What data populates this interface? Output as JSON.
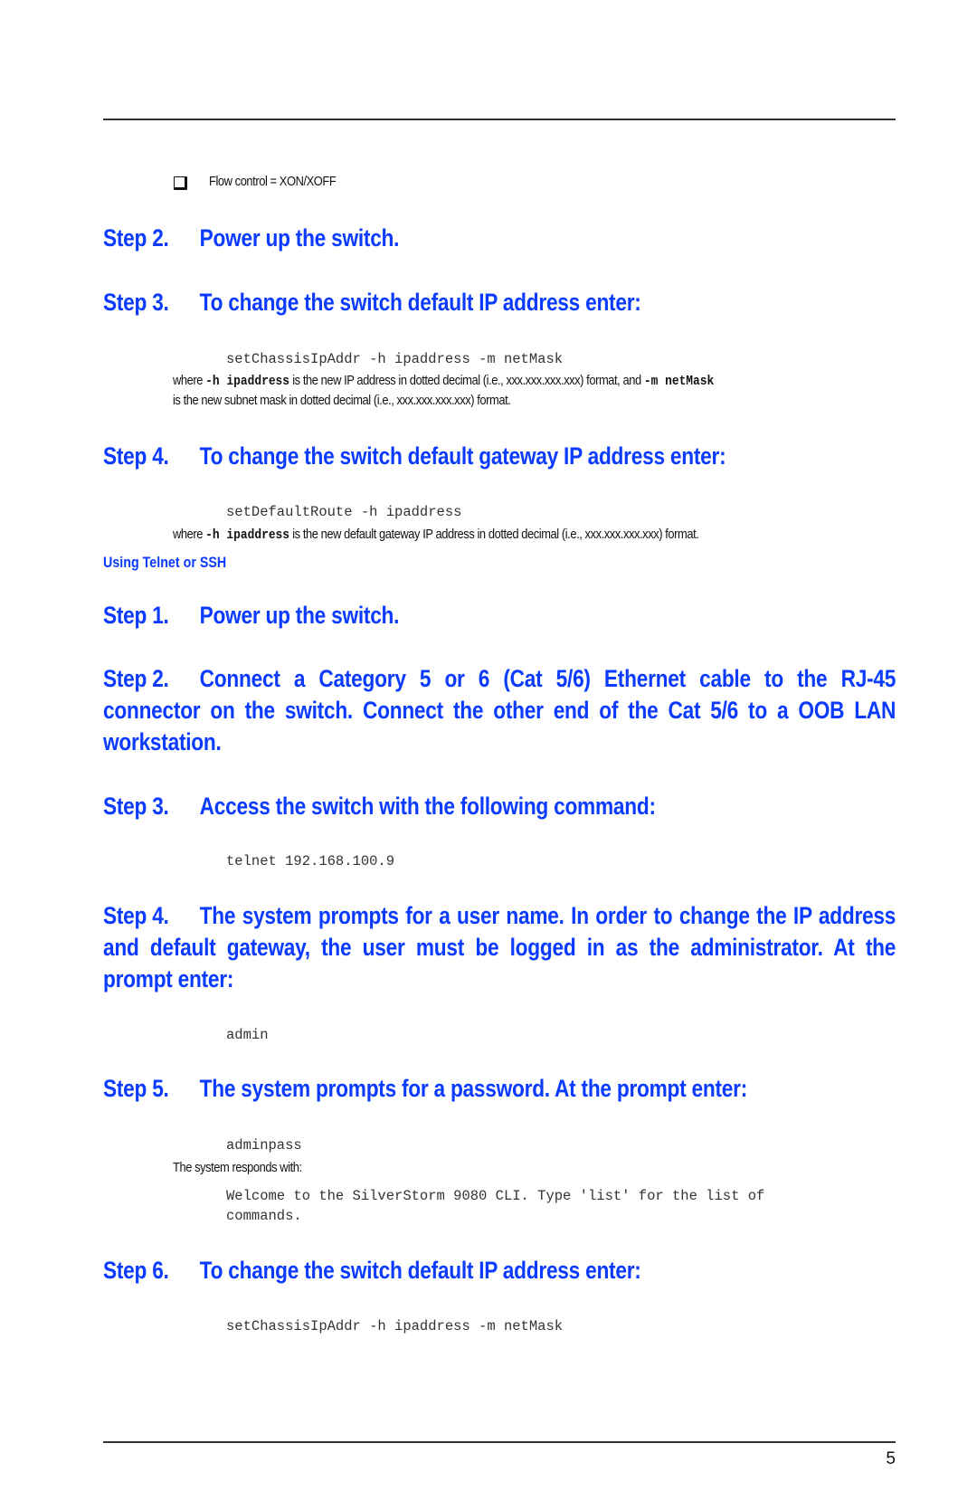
{
  "bullet": {
    "text": "Flow control = XON/XOFF"
  },
  "section1": {
    "steps": [
      {
        "num": "Step 2.",
        "text": "Power up the switch."
      },
      {
        "num": "Step 3.",
        "text": "To change the switch default IP address enter:"
      }
    ],
    "code1": "setChassisIpAddr -h ipaddress -m netMask",
    "where1": {
      "prefix": "where ",
      "flag1": "-h ipaddress",
      "mid": " is the new IP address in dotted decimal (i.e., xxx.xxx.xxx.xxx) format, and ",
      "flag2": "-m netMask",
      "line2": "is the new subnet mask in dotted decimal (i.e., xxx.xxx.xxx.xxx) format."
    },
    "step4": {
      "num": "Step 4.",
      "text": "To change the switch default gateway IP address enter:"
    },
    "code2": "setDefaultRoute -h ipaddress",
    "where2": {
      "prefix": "where ",
      "flag": "-h ipaddress",
      "rest": " is the new default gateway IP address in dotted decimal (i.e., xxx.xxx.xxx.xxx) format."
    }
  },
  "section2": {
    "title": "Using Telnet or SSH",
    "step1": {
      "num": "Step 1.",
      "text": "Power up the switch."
    },
    "step2": {
      "num": "Step 2.",
      "text": "Connect a Category 5 or 6 (Cat 5/6) Ethernet cable to the RJ-45 connector on the switch. Connect the other end of the Cat 5/6 to a OOB LAN workstation."
    },
    "step3": {
      "num": "Step 3.",
      "text": "Access the switch with the following command:"
    },
    "code_telnet": "telnet 192.168.100.9",
    "step4": {
      "num": "Step 4.",
      "text": "The system prompts for a user name. In order to change the IP address and default gateway, the user must be logged in as the administrator. At the prompt enter:"
    },
    "code_admin": "admin",
    "step5": {
      "num": "Step 5.",
      "text": "The system prompts for a password. At the prompt enter:"
    },
    "code_pass": "adminpass",
    "responds": "The system responds with:",
    "welcome_line1": "Welcome to the SilverStorm 9080 CLI. Type 'list' for the list of",
    "welcome_line2": "commands.",
    "step6": {
      "num": "Step 6.",
      "text": "To change the switch default IP address enter:"
    },
    "code_final": "setChassisIpAddr -h ipaddress -m netMask"
  },
  "footer": {
    "page_number": "5"
  }
}
